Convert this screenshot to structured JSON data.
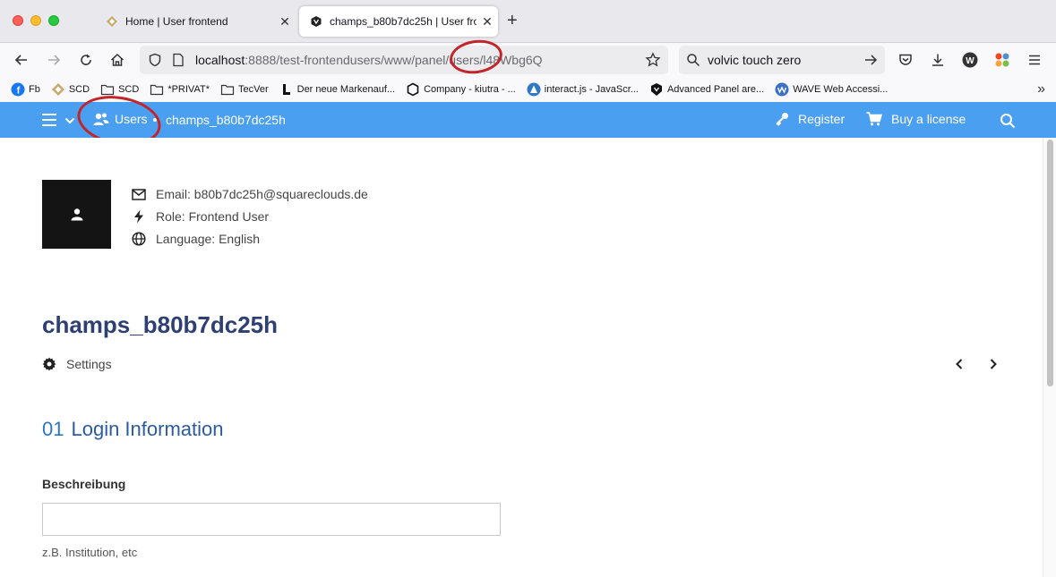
{
  "browser": {
    "tabs": [
      {
        "title": "Home | User frontend",
        "active": false,
        "icon": "site-favicon"
      },
      {
        "title": "champs_b80b7dc25h | User fron",
        "active": true,
        "icon": "cms-favicon"
      }
    ],
    "url_host": "localhost",
    "url_rest": ":8888/test-frontendusers/www/panel/users/l48Wbg6Q",
    "search_text": "volvic touch zero",
    "bookmarks": [
      {
        "label": "Fb",
        "icon": "facebook-icon"
      },
      {
        "label": "SCD",
        "icon": "site-icon"
      },
      {
        "label": "SCD",
        "icon": "folder-icon"
      },
      {
        "label": "*PRIVAT*",
        "icon": "folder-icon"
      },
      {
        "label": "TecVer",
        "icon": "folder-icon"
      },
      {
        "label": "Der neue Markenauf...",
        "icon": "l-icon"
      },
      {
        "label": "Company - kiutra - ...",
        "icon": "hexagon-icon"
      },
      {
        "label": "interact.js - JavaScr...",
        "icon": "triangle-icon"
      },
      {
        "label": "Advanced Panel are...",
        "icon": "shield-icon"
      },
      {
        "label": "WAVE Web Accessi...",
        "icon": "wave-icon"
      }
    ]
  },
  "header": {
    "breadcrumb_users": "Users",
    "breadcrumb_current": "champs_b80b7dc25h",
    "register_label": "Register",
    "buy_label": "Buy a license",
    "bar_color": "#4a9ff0"
  },
  "profile": {
    "email": "Email: b80b7dc25h@squareclouds.de",
    "role": "Role: Frontend User",
    "language": "Language: English",
    "name": "champs_b80b7dc25h",
    "settings_label": "Settings"
  },
  "section": {
    "number": "01",
    "title": "Login Information",
    "field_label": "Beschreibung",
    "field_value": "",
    "field_hint": "z.B. Institution, etc"
  }
}
